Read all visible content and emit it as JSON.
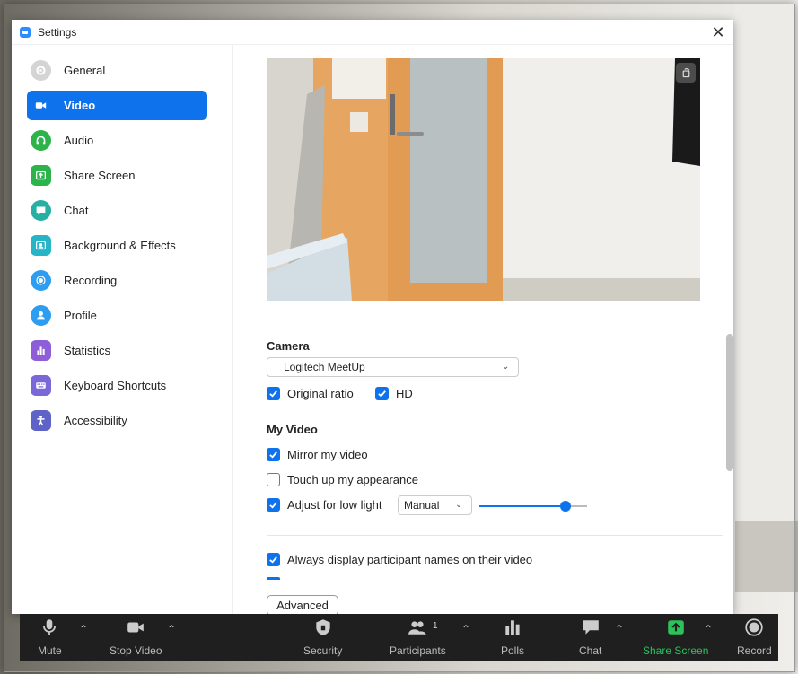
{
  "window": {
    "title": "Settings"
  },
  "sidebar": {
    "items": [
      {
        "label": "General",
        "icon": "gear-icon",
        "color": "#d4d4d4"
      },
      {
        "label": "Video",
        "icon": "video-camera-icon",
        "color": "#0e72ed",
        "active": true
      },
      {
        "label": "Audio",
        "icon": "headphones-icon",
        "color": "#2cb34a"
      },
      {
        "label": "Share Screen",
        "icon": "share-screen-icon",
        "color": "#2cb34a"
      },
      {
        "label": "Chat",
        "icon": "chat-bubble-icon",
        "color": "#26b0a3"
      },
      {
        "label": "Background & Effects",
        "icon": "background-icon",
        "color": "#27b4c6"
      },
      {
        "label": "Recording",
        "icon": "recording-icon",
        "color": "#2c9df0"
      },
      {
        "label": "Profile",
        "icon": "profile-icon",
        "color": "#2c9df0"
      },
      {
        "label": "Statistics",
        "icon": "statistics-icon",
        "color": "#8e5ed8"
      },
      {
        "label": "Keyboard Shortcuts",
        "icon": "keyboard-icon",
        "color": "#7a67d8"
      },
      {
        "label": "Accessibility",
        "icon": "accessibility-icon",
        "color": "#5f63c8"
      }
    ]
  },
  "video": {
    "camera_heading": "Camera",
    "camera_select": "Logitech MeetUp",
    "original_ratio_label": "Original ratio",
    "original_ratio_checked": true,
    "hd_label": "HD",
    "hd_checked": true,
    "my_video_heading": "My Video",
    "mirror_label": "Mirror my video",
    "mirror_checked": true,
    "touchup_label": "Touch up my appearance",
    "touchup_checked": false,
    "low_light_label": "Adjust for low light",
    "low_light_checked": true,
    "low_light_mode": "Manual",
    "low_light_level": 0.8,
    "names_label": "Always display participant names on their video",
    "names_checked": true,
    "advanced_button": "Advanced"
  },
  "toolbar": {
    "mute": "Mute",
    "stop_video": "Stop Video",
    "security": "Security",
    "participants": "Participants",
    "participants_count": "1",
    "polls": "Polls",
    "chat": "Chat",
    "share_screen": "Share Screen",
    "record": "Record"
  },
  "colors": {
    "accent": "#0e72ed",
    "share_green": "#2cc25a"
  }
}
